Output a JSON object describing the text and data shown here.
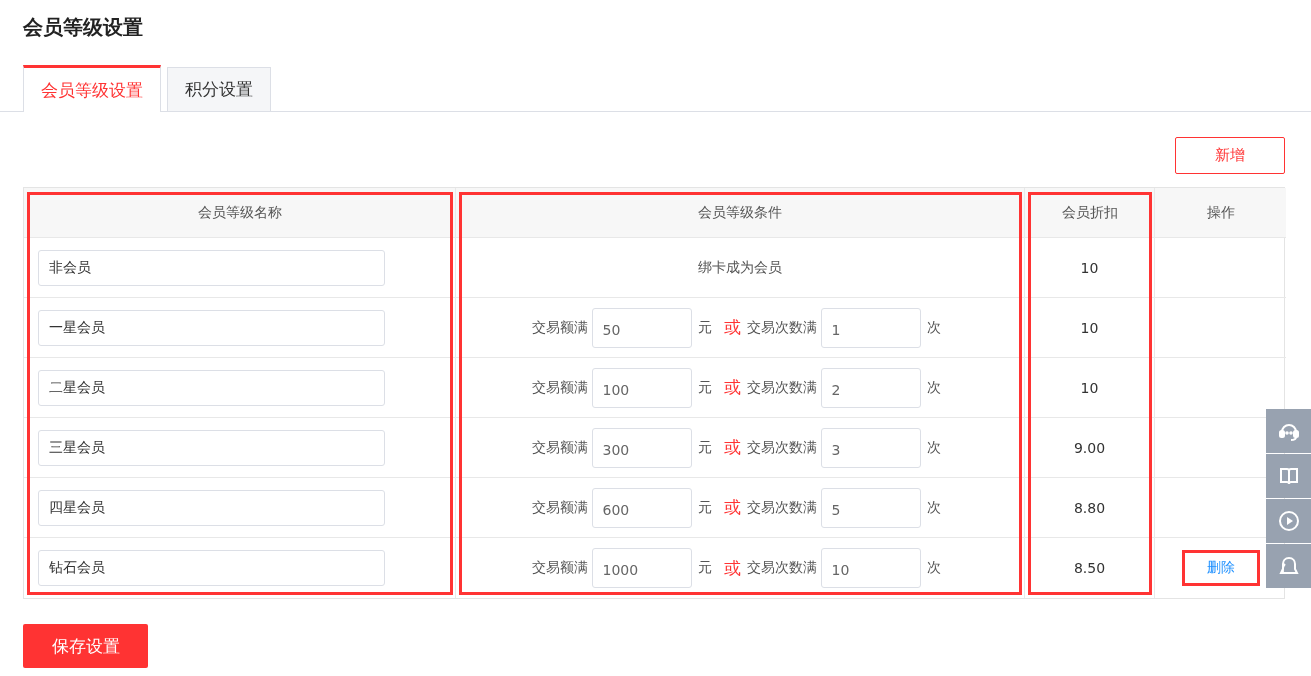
{
  "title": "会员等级设置",
  "tabs": [
    {
      "label": "会员等级设置",
      "selected": true
    },
    {
      "label": "积分设置",
      "selected": false
    }
  ],
  "add_button": "新增",
  "table": {
    "columns": [
      {
        "label": "会员等级名称",
        "highlighted": true
      },
      {
        "label": "会员等级条件",
        "highlighted": true
      },
      {
        "label": "会员折扣",
        "highlighted": true
      },
      {
        "label": "操作",
        "highlighted": false
      }
    ],
    "rows": [
      {
        "name": "非会员",
        "condition": {
          "kind": "text",
          "text": "绑卡成为会员"
        },
        "discount": "10"
      },
      {
        "name": "一星会员",
        "condition": {
          "kind": "thresholds",
          "amount_label": "交易额满",
          "amount": "50",
          "amount_unit": "元",
          "or": "或",
          "count_label": "交易次数满",
          "count": "1",
          "count_unit": "次"
        },
        "discount": "10"
      },
      {
        "name": "二星会员",
        "condition": {
          "kind": "thresholds",
          "amount_label": "交易额满",
          "amount": "100",
          "amount_unit": "元",
          "or": "或",
          "count_label": "交易次数满",
          "count": "2",
          "count_unit": "次"
        },
        "discount": "10"
      },
      {
        "name": "三星会员",
        "condition": {
          "kind": "thresholds",
          "amount_label": "交易额满",
          "amount": "300",
          "amount_unit": "元",
          "or": "或",
          "count_label": "交易次数满",
          "count": "3",
          "count_unit": "次"
        },
        "discount": "9.00"
      },
      {
        "name": "四星会员",
        "condition": {
          "kind": "thresholds",
          "amount_label": "交易额满",
          "amount": "600",
          "amount_unit": "元",
          "or": "或",
          "count_label": "交易次数满",
          "count": "5",
          "count_unit": "次"
        },
        "discount": "8.80"
      },
      {
        "name": "钻石会员",
        "condition": {
          "kind": "thresholds",
          "amount_label": "交易额满",
          "amount": "1000",
          "amount_unit": "元",
          "or": "或",
          "count_label": "交易次数满",
          "count": "10",
          "count_unit": "次"
        },
        "discount": "8.50",
        "action": {
          "label": "删除",
          "highlighted": true
        }
      }
    ]
  },
  "save_button": "保存设置",
  "side_toolbar": [
    {
      "kind": "headset"
    },
    {
      "kind": "book"
    },
    {
      "kind": "play"
    },
    {
      "kind": "bell"
    }
  ]
}
